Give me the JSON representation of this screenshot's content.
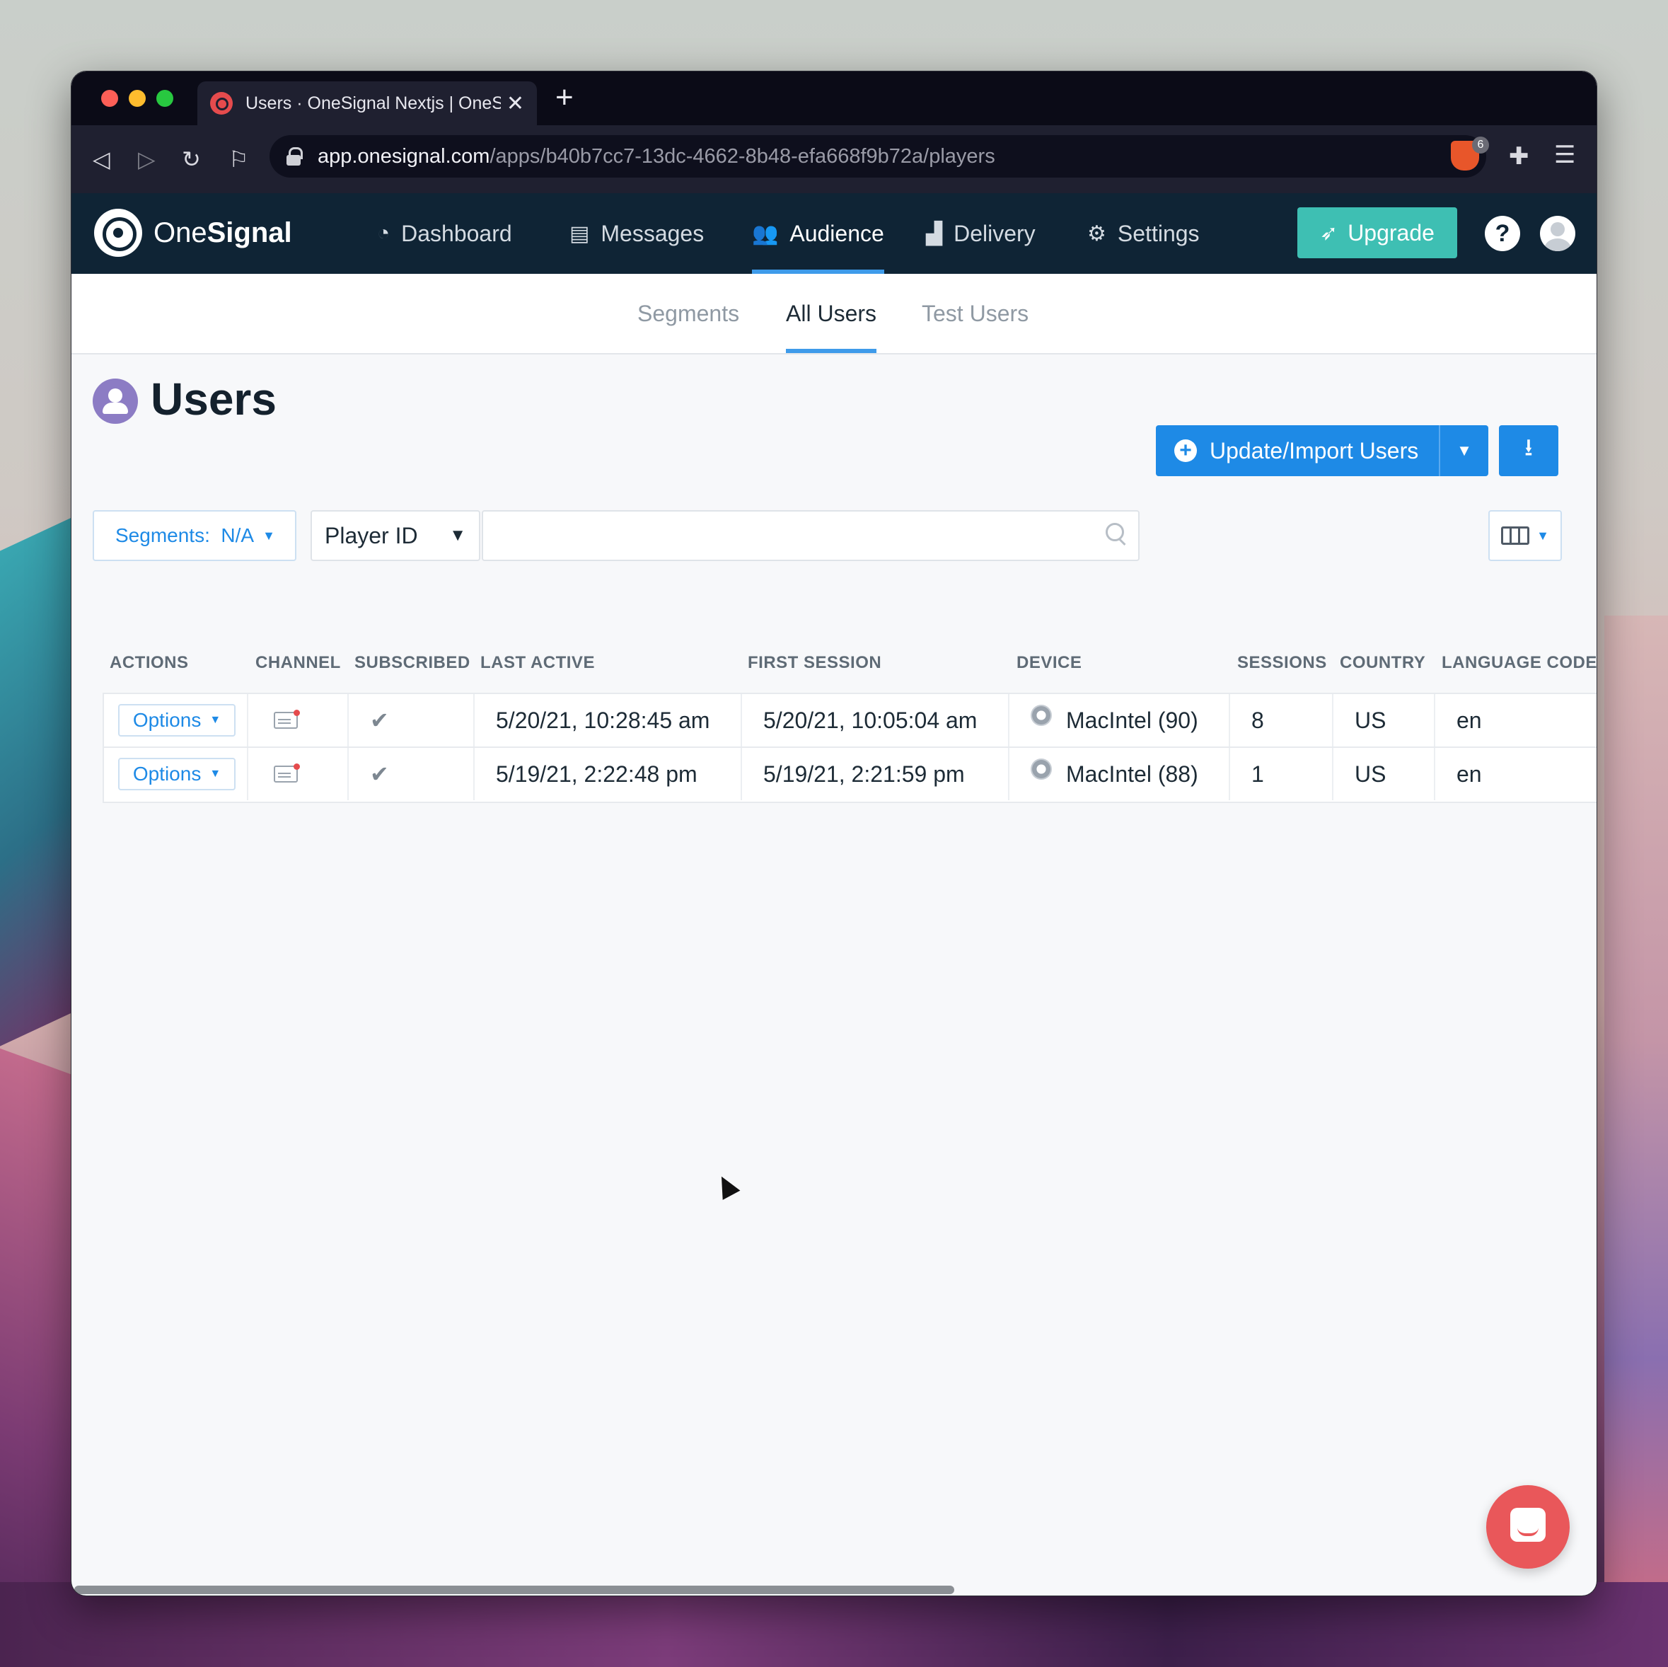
{
  "browser": {
    "tab_title": "Users · OneSignal Nextjs | OneS",
    "tab_close": "✕",
    "new_tab": "+",
    "url_host": "app.onesignal.com",
    "url_path": "/apps/b40b7cc7-13dc-4662-8b48-efa668f9b72a/players",
    "brave_badge": "6"
  },
  "brand": {
    "name_light": "One",
    "name_bold": "Signal"
  },
  "nav": {
    "items": [
      {
        "label": "Dashboard",
        "icon": "gauge-icon"
      },
      {
        "label": "Messages",
        "icon": "chat-icon"
      },
      {
        "label": "Audience",
        "icon": "users-icon",
        "active": true
      },
      {
        "label": "Delivery",
        "icon": "bar-chart-icon"
      },
      {
        "label": "Settings",
        "icon": "gear-icon"
      }
    ],
    "upgrade_label": "Upgrade",
    "help_label": "?"
  },
  "subnav": {
    "tabs": [
      {
        "label": "Segments"
      },
      {
        "label": "All Users",
        "active": true
      },
      {
        "label": "Test Users"
      }
    ]
  },
  "page": {
    "title": "Users",
    "import_label": "Update/Import Users"
  },
  "filters": {
    "segments_label": "Segments:  N/A",
    "field_select": "Player ID",
    "search_value": "",
    "search_placeholder": ""
  },
  "table": {
    "headers": [
      "ACTIONS",
      "CHANNEL",
      "SUBSCRIBED",
      "LAST ACTIVE",
      "FIRST SESSION",
      "DEVICE",
      "SESSIONS",
      "COUNTRY",
      "LANGUAGE CODE"
    ],
    "rows": [
      {
        "action": "Options",
        "subscribed": "✔",
        "last_active": "5/20/21, 10:28:45 am",
        "first_session": "5/20/21, 10:05:04 am",
        "device": "MacIntel (90)",
        "sessions": "8",
        "country": "US",
        "language": "en"
      },
      {
        "action": "Options",
        "subscribed": "✔",
        "last_active": "5/19/21, 2:22:48 pm",
        "first_session": "5/19/21, 2:21:59 pm",
        "device": "MacIntel (88)",
        "sessions": "1",
        "country": "US",
        "language": "en"
      }
    ]
  },
  "colors": {
    "nav_bg": "#0f2435",
    "accent": "#1e8ae6",
    "upgrade": "#3ebfb3",
    "intercom": "#e9575a"
  }
}
